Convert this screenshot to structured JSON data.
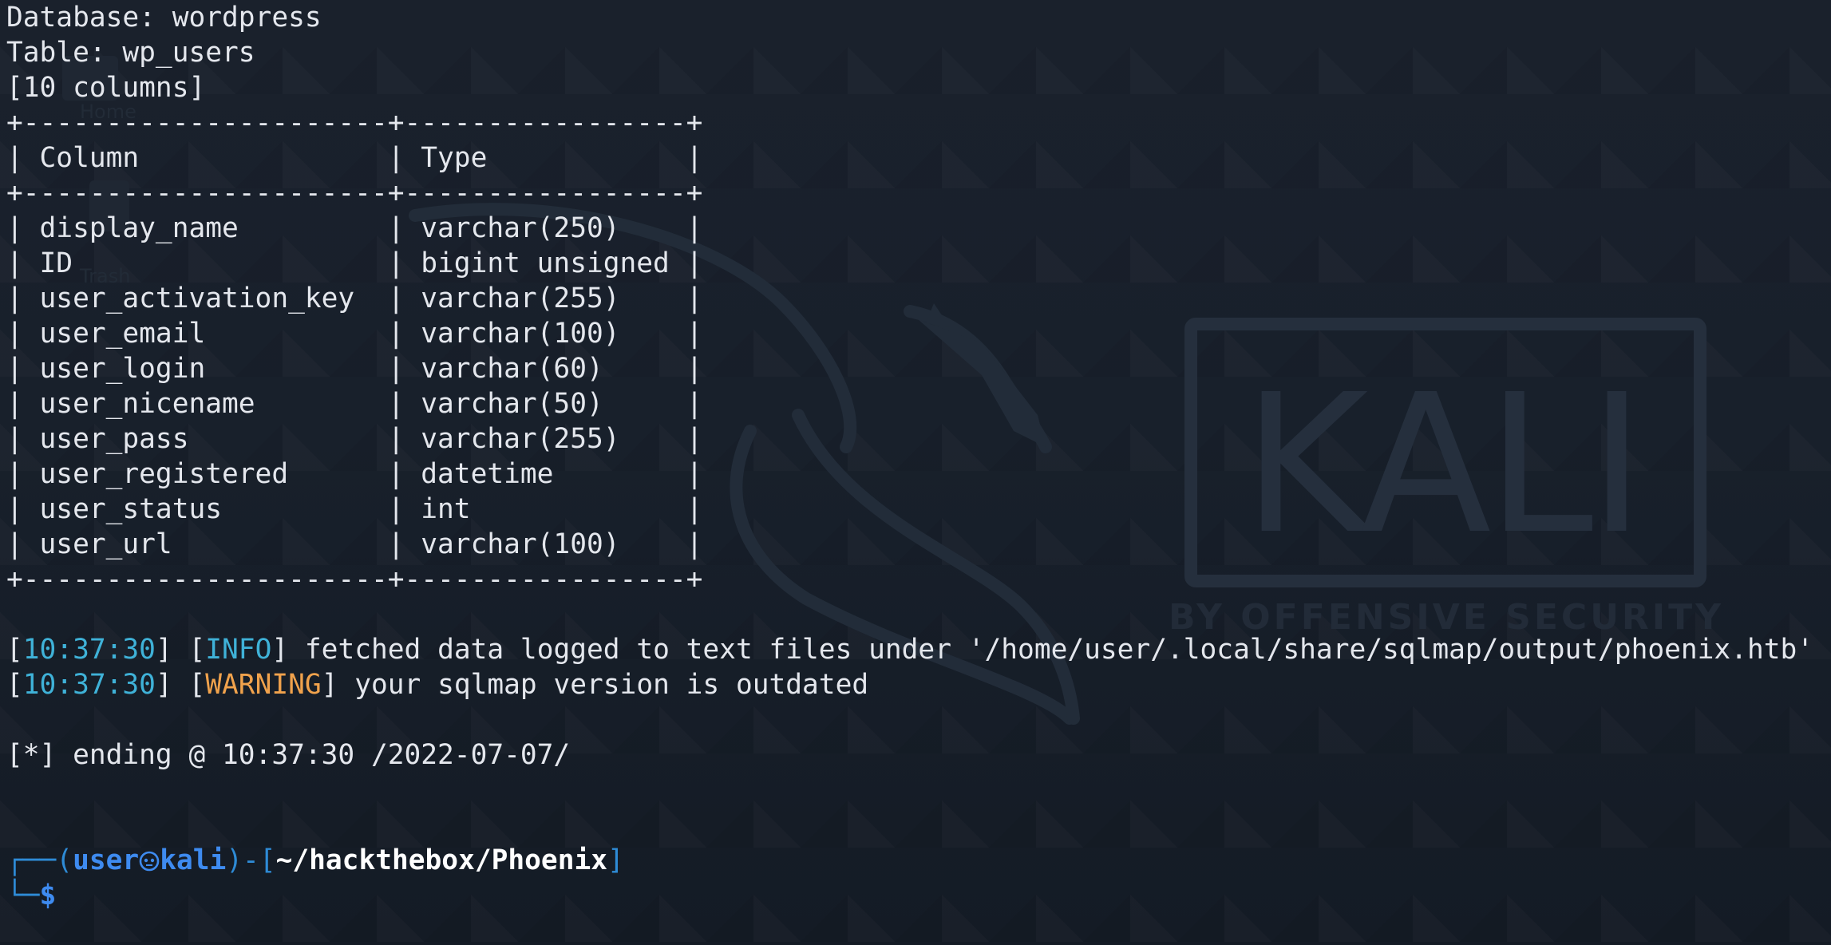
{
  "header": {
    "database_line": "Database: wordpress",
    "table_line": "Table: wp_users",
    "columns_line": "[10 columns]"
  },
  "table": {
    "border_top": "+----------------------+-----------------+",
    "header_row": "| Column               | Type            |",
    "border_mid": "+----------------------+-----------------+",
    "rows": [
      "| display_name         | varchar(250)    |",
      "| ID                   | bigint unsigned |",
      "| user_activation_key  | varchar(255)    |",
      "| user_email           | varchar(100)    |",
      "| user_login           | varchar(60)     |",
      "| user_nicename        | varchar(50)     |",
      "| user_pass            | varchar(255)    |",
      "| user_registered      | datetime        |",
      "| user_status          | int             |",
      "| user_url             | varchar(100)    |"
    ],
    "border_bottom": "+----------------------+-----------------+"
  },
  "log": [
    {
      "open": "[",
      "time": "10:37:30",
      "mid": "] [",
      "level": "INFO",
      "close": "] ",
      "message": "fetched data logged to text files under '/home/user/.local/share/sqlmap/output/phoenix.htb'"
    },
    {
      "open": "[",
      "time": "10:37:30",
      "mid": "] [",
      "level": "WARNING",
      "close": "] ",
      "message": "your sqlmap version is outdated"
    }
  ],
  "ending_line": "[*] ending @ 10:37:30 /2022-07-07/",
  "prompt": {
    "frame_top": "┌──(",
    "user": "user",
    "host": "kali",
    "sep": ")-[",
    "path": "~/hackthebox/Phoenix",
    "close": "]",
    "frame_bottom": "└─",
    "symbol": "$"
  },
  "wallpaper": {
    "brand": "KALI",
    "tagline": "BY OFFENSIVE SECURITY",
    "desktop_icons": [
      "Home",
      "Trash"
    ]
  },
  "colors": {
    "background": "#18202b",
    "text": "#e4e7ed",
    "timestamp": "#3fb2d8",
    "warning": "#f0a24c",
    "prompt_user": "#3e8bf0",
    "prompt_frame": "#2e8bd6"
  }
}
